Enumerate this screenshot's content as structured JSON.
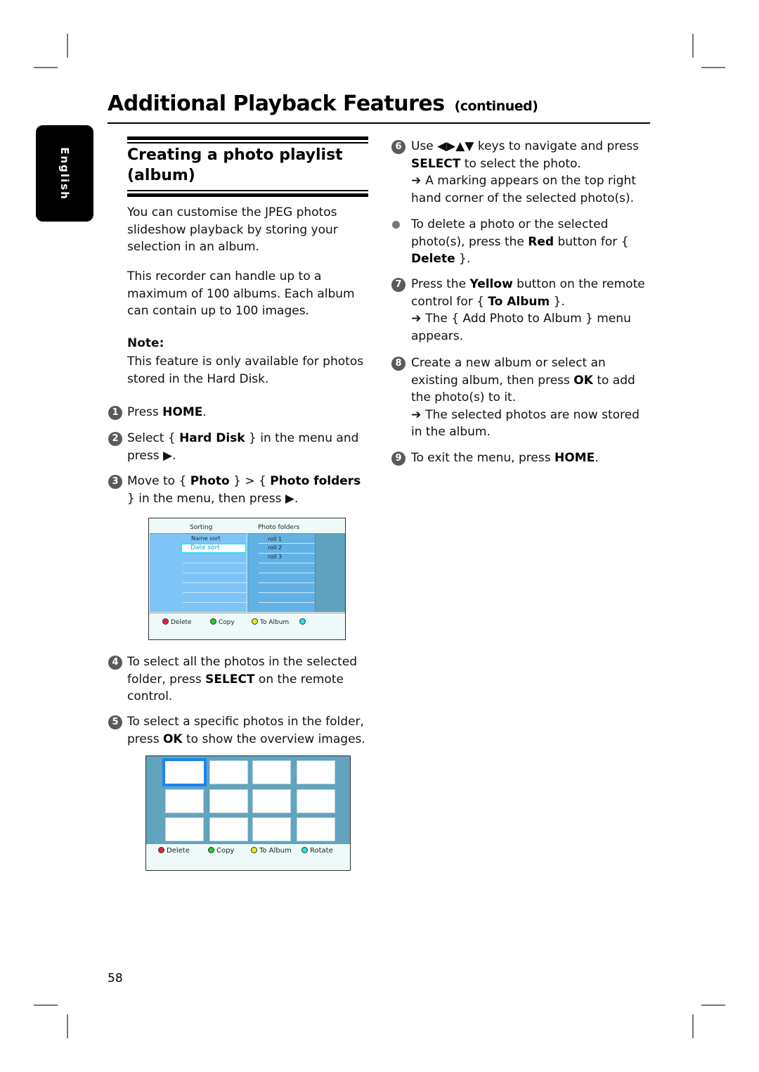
{
  "header": {
    "title": "Additional Playback Features",
    "title_suffix": "(continued)"
  },
  "language_tab": "English",
  "section": {
    "title": "Creating a photo playlist (album)"
  },
  "intro": {
    "para1": "You can customise the JPEG photos slideshow playback by storing your selection in an album.",
    "para2": "This recorder can handle up to a maximum of 100 albums.  Each album can contain up to 100 images."
  },
  "note": {
    "title": "Note:",
    "text": "This feature is only available for photos stored in the Hard Disk."
  },
  "steps": [
    {
      "num": "1",
      "pre": "Press ",
      "bold": "HOME",
      "post": "."
    },
    {
      "num": "2",
      "pre": "Select { ",
      "bold": "Hard Disk",
      "post": " } in the menu and press ▶."
    },
    {
      "num": "3",
      "pre": "Move to { ",
      "bold": "Photo",
      "mid": " } > { ",
      "bold2": "Photo folders",
      "post": " } in the menu, then press ▶."
    },
    {
      "num": "4",
      "pre": "To select all the photos in the selected folder, press ",
      "bold": "SELECT",
      "post": " on the remote control."
    },
    {
      "num": "5",
      "pre": "To select a specific photos in the folder, press ",
      "bold": "OK",
      "post": " to show the overview images."
    },
    {
      "num": "6",
      "pre": "Use ◀▶▲▼ keys to navigate and press ",
      "bold": "SELECT",
      "post": " to select the photo.",
      "result": "A marking appears on the top right hand corner of the selected photo(s)."
    },
    {
      "num": "7",
      "pre": "Press the ",
      "bold": "Yellow",
      "mid": " button on the remote control for { ",
      "bold2": "To Album",
      "post": " }.",
      "result": "The { Add Photo to Album } menu appears."
    },
    {
      "num": "8",
      "pre": "Create a new album or select an existing album, then press ",
      "bold": "OK",
      "post": " to add the photo(s) to it.",
      "result": "The selected photos are now stored in the album."
    },
    {
      "num": "9",
      "pre": "To exit the menu, press ",
      "bold": "HOME",
      "post": "."
    }
  ],
  "bullet_delete": {
    "pre": "To delete a photo or the selected photo(s), press the ",
    "bold": "Red",
    "mid": " button for { ",
    "bold2": "Delete",
    "post": " }."
  },
  "menu_folders": {
    "col_sorting": "Sorting",
    "col_folders": "Photo folders",
    "sort_options": [
      "Name sort",
      "Date sort"
    ],
    "selected_sort": "Date sort",
    "folders": [
      "roll 1",
      "roll 2",
      "roll 3"
    ],
    "keys": [
      {
        "label": "Delete",
        "color": "#e8203a"
      },
      {
        "label": "Copy",
        "color": "#20d020"
      },
      {
        "label": "To Album",
        "color": "#f0e818"
      },
      {
        "label": "",
        "color": "#2ee0ea"
      }
    ]
  },
  "menu_overview": {
    "rows": 3,
    "cols": 4,
    "selected_index": 0,
    "keys": [
      {
        "label": "Delete",
        "color": "#e8203a"
      },
      {
        "label": "Copy",
        "color": "#20d020"
      },
      {
        "label": "To Album",
        "color": "#f0e818"
      },
      {
        "label": "Rotate",
        "color": "#2ee0ea"
      }
    ]
  },
  "arrow_glyph": "➔",
  "page_number": "58"
}
